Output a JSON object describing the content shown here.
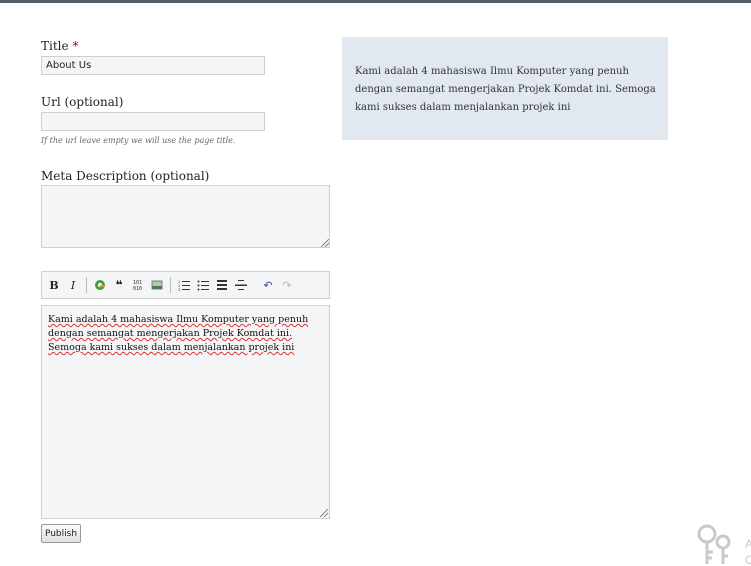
{
  "form": {
    "title_label": "Title",
    "required_mark": "*",
    "title_value": "About Us",
    "url_label": "Url (optional)",
    "url_value": "",
    "url_hint": "If the url leave empty we will use the page title.",
    "meta_label": "Meta Description (optional)",
    "meta_value": "",
    "publish_label": "Publish"
  },
  "toolbar": {
    "buttons": [
      {
        "name": "bold",
        "glyph": "B"
      },
      {
        "name": "italic",
        "glyph": "I"
      },
      {
        "name": "link",
        "glyph": "🔗"
      },
      {
        "name": "blockquote",
        "glyph": "❝"
      },
      {
        "name": "code",
        "glyph": "01"
      },
      {
        "name": "image",
        "glyph": "▤"
      },
      {
        "name": "numbered-list",
        "glyph": "≡"
      },
      {
        "name": "bulleted-list",
        "glyph": "≡"
      },
      {
        "name": "heading",
        "glyph": "☰"
      },
      {
        "name": "horizontal-rule",
        "glyph": "═"
      },
      {
        "name": "undo",
        "glyph": "↶"
      },
      {
        "name": "redo",
        "glyph": "↷"
      }
    ]
  },
  "editor": {
    "content": "Kami adalah 4 mahasiswa Ilmu Komputer yang penuh dengan semangat mengerjakan Projek Komdat ini. Semoga kami sukses dalam menjalankan projek ini"
  },
  "preview": {
    "content": "Kami adalah 4 mahasiswa Ilmu Komputer yang penuh dengan semangat mengerjakan Projek Komdat ini. Semoga kami sukses dalam menjalankan projek ini"
  },
  "colors": {
    "topbar": "#555d66",
    "preview_bg": "#e1e8ef",
    "required": "#cc0000"
  }
}
